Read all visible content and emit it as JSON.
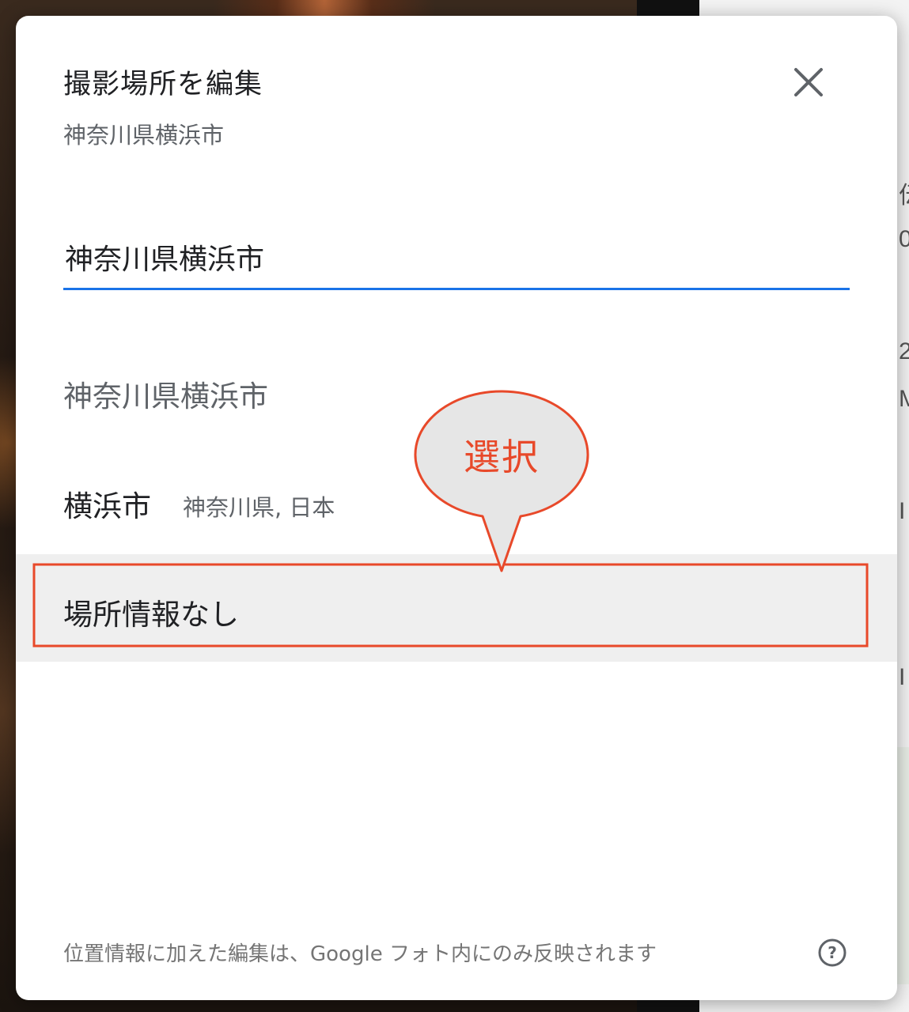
{
  "background": {
    "peek_glyphs": [
      "伝",
      "0",
      "2",
      "M",
      "I",
      "I"
    ]
  },
  "dialog": {
    "title": "撮影場所を編集",
    "subtitle": "神奈川県横浜市",
    "close_icon": "close-icon",
    "search": {
      "value": "神奈川県横浜市",
      "placeholder": ""
    },
    "suggestions": [
      {
        "main": "神奈川県横浜市",
        "secondary": ""
      },
      {
        "main": "横浜市",
        "secondary": "神奈川県, 日本"
      },
      {
        "main": "場所情報なし",
        "secondary": ""
      }
    ],
    "footer_note": "位置情報に加えた編集は、Google フォト内にのみ反映されます",
    "help_icon": "help-circle-icon"
  },
  "annotation": {
    "label": "選択",
    "color": "#e8492a",
    "highlighted_item": "場所情報なし"
  },
  "colors": {
    "accent_blue": "#1a73e8",
    "annotation_red": "#e8492a",
    "selected_row_bg": "#efefef"
  }
}
